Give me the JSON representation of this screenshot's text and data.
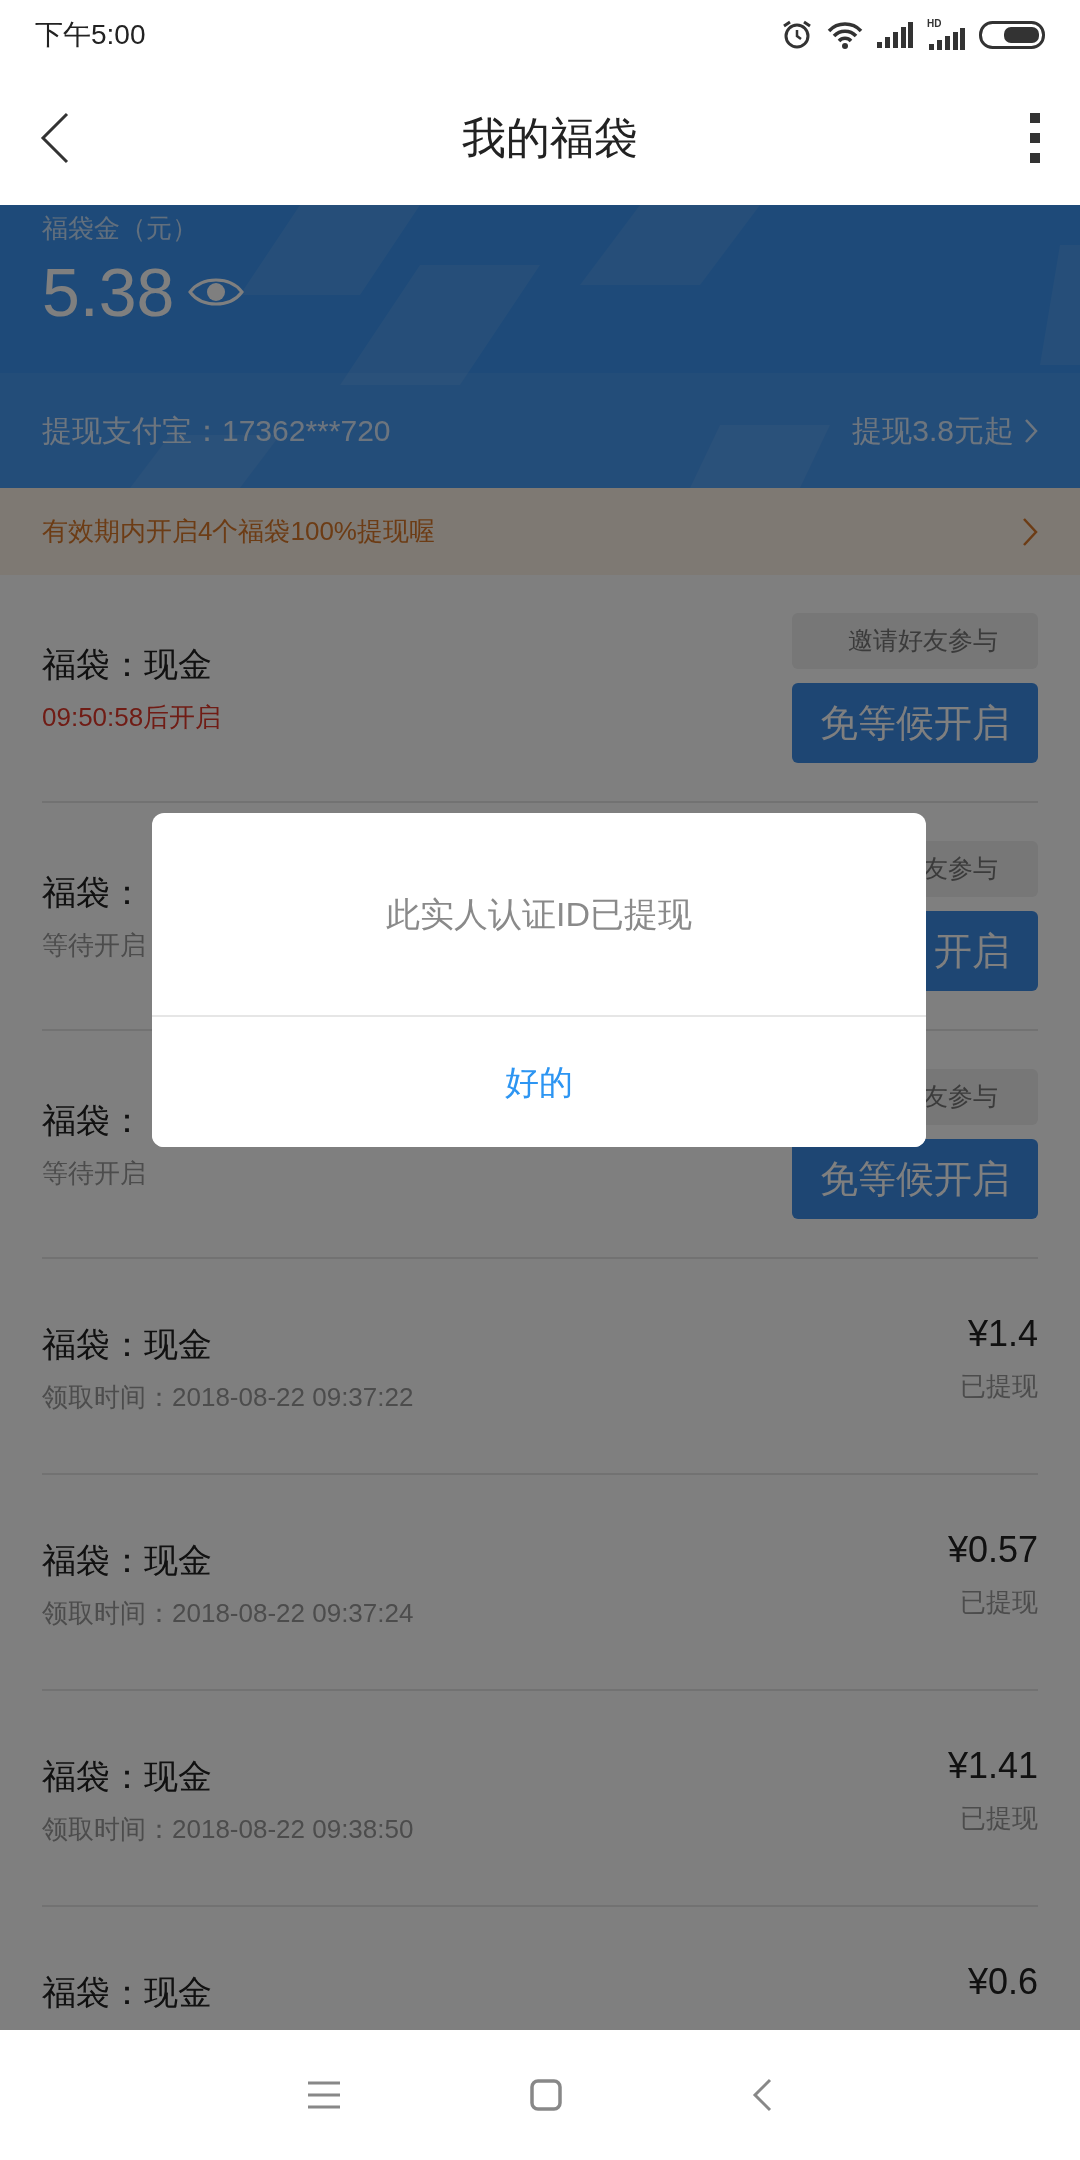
{
  "status_bar": {
    "time": "下午5:00",
    "network_label": "HD"
  },
  "nav": {
    "title": "我的福袋"
  },
  "balance": {
    "label": "福袋金（元）",
    "amount": "5.38",
    "account": "提现支付宝：17362***720",
    "withdraw_hint": "提现3.8元起"
  },
  "notice": {
    "text": "有效期内开启4个福袋100%提现喔"
  },
  "items": [
    {
      "kind": "pending",
      "title": "福袋：现金",
      "status": "09:50:58后开启",
      "highlight": true,
      "bubble": "邀请好友参与",
      "button": "免等候开启"
    },
    {
      "kind": "pending",
      "title": "福袋：",
      "status": "等待开启",
      "highlight": false,
      "bubble": "友参与",
      "button": "开启"
    },
    {
      "kind": "pending",
      "title": "福袋：",
      "status": "等待开启",
      "highlight": false,
      "bubble": "友参与",
      "button": "免等候开启"
    },
    {
      "kind": "claimed",
      "title": "福袋：现金",
      "time": "领取时间：2018-08-22 09:37:22",
      "amount": "¥1.4",
      "state": "已提现"
    },
    {
      "kind": "claimed",
      "title": "福袋：现金",
      "time": "领取时间：2018-08-22 09:37:24",
      "amount": "¥0.57",
      "state": "已提现"
    },
    {
      "kind": "claimed",
      "title": "福袋：现金",
      "time": "领取时间：2018-08-22 09:38:50",
      "amount": "¥1.41",
      "state": "已提现"
    },
    {
      "kind": "claimed",
      "title": "福袋：现金",
      "amount": "¥0.6"
    }
  ],
  "dialog": {
    "message": "此实人认证ID已提现",
    "button": "好的"
  }
}
